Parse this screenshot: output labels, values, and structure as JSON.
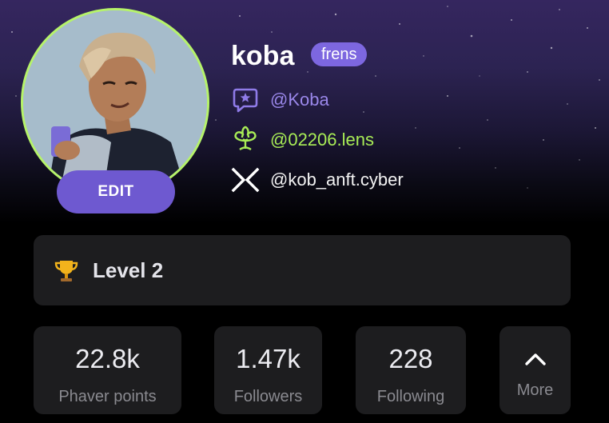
{
  "profile": {
    "username": "koba",
    "badge": "frens",
    "edit_label": "EDIT",
    "avatar_ring_color": "#b6f36a"
  },
  "socials": [
    {
      "icon": "chat-star-icon",
      "handle": "@Koba",
      "color": "#9a87ea"
    },
    {
      "icon": "lens-icon",
      "handle": "@02206.lens",
      "color": "#a8ec56"
    },
    {
      "icon": "cyberconnect-icon",
      "handle": "@kob_anft.cyber",
      "color": "#f2f2f2"
    }
  ],
  "level": {
    "icon": "trophy-icon",
    "label": "Level 2"
  },
  "stats": [
    {
      "value": "22.8k",
      "label": "Phaver points"
    },
    {
      "value": "1.47k",
      "label": "Followers"
    },
    {
      "value": "228",
      "label": "Following"
    }
  ],
  "more": {
    "icon": "chevron-up-icon",
    "label": "More"
  },
  "colors": {
    "accent": "#6e59d0",
    "badge": "#7d67e0",
    "card": "#1d1d1f",
    "lens_green": "#a8ec56"
  }
}
